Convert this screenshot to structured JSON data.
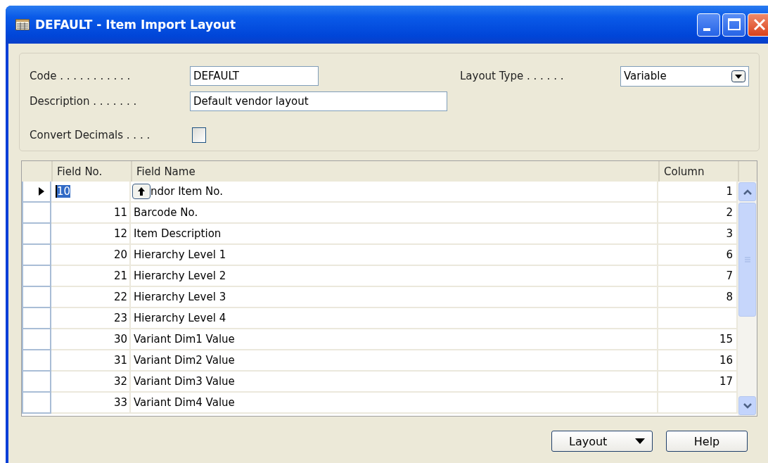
{
  "window": {
    "title": "DEFAULT - Item Import Layout"
  },
  "header": {
    "code": {
      "label": "Code . . . . . . . . . . .",
      "value": "DEFAULT"
    },
    "description": {
      "label": "Description . . . . . . .",
      "value": "Default vendor layout"
    },
    "convert_decimals": {
      "label": "Convert Decimals . . . .",
      "checked": false
    },
    "layout_type": {
      "label": "Layout Type . . . . . .",
      "value": "Variable"
    }
  },
  "table": {
    "columns": [
      "Field No.",
      "Field Name",
      "Column"
    ],
    "rows": [
      {
        "field_no": "10",
        "field_name": "ndor Item No.",
        "column": "1",
        "selected": true
      },
      {
        "field_no": "11",
        "field_name": "Barcode No.",
        "column": "2",
        "selected": false
      },
      {
        "field_no": "12",
        "field_name": "Item Description",
        "column": "3",
        "selected": false
      },
      {
        "field_no": "20",
        "field_name": "Hierarchy Level 1",
        "column": "6",
        "selected": false
      },
      {
        "field_no": "21",
        "field_name": "Hierarchy Level 2",
        "column": "7",
        "selected": false
      },
      {
        "field_no": "22",
        "field_name": "Hierarchy Level 3",
        "column": "8",
        "selected": false
      },
      {
        "field_no": "23",
        "field_name": "Hierarchy Level 4",
        "selected": false
      },
      {
        "field_no": "30",
        "field_name": "Variant Dim1 Value",
        "column": "15",
        "selected": false
      },
      {
        "field_no": "31",
        "field_name": "Variant Dim2 Value",
        "column": "16",
        "selected": false
      },
      {
        "field_no": "32",
        "field_name": "Variant Dim3 Value",
        "column": "17",
        "selected": false
      },
      {
        "field_no": "33",
        "field_name": "Variant Dim4 Value",
        "selected": false
      }
    ]
  },
  "buttons": [
    {
      "label": "Layout",
      "dropdown": true
    },
    {
      "label": "Help",
      "dropdown": false
    }
  ]
}
